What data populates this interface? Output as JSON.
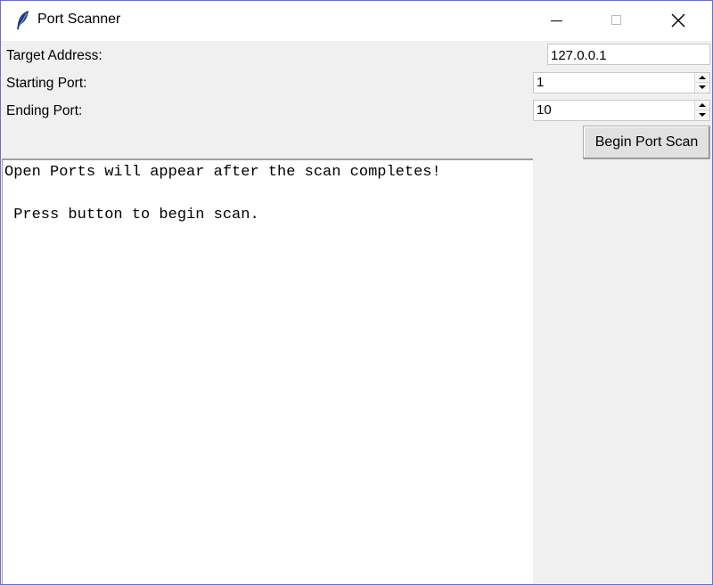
{
  "window": {
    "title": "Port Scanner",
    "icon": "feather-icon",
    "controls": [
      "minimize-icon",
      "maximize-icon",
      "close-icon"
    ]
  },
  "form": {
    "target_label": "Target Address:",
    "target_value": "127.0.0.1",
    "start_label": "Starting Port:",
    "start_value": "1",
    "end_label": "Ending Port:",
    "end_value": "10"
  },
  "actions": {
    "scan_label": "Begin Port Scan"
  },
  "output": {
    "line1": "Open Ports will appear after the scan completes!",
    "line2": " Press button to begin scan."
  },
  "colors": {
    "window_border": "#6b6fbf",
    "background": "#f0f0f0",
    "titlebar": "#ffffff"
  }
}
